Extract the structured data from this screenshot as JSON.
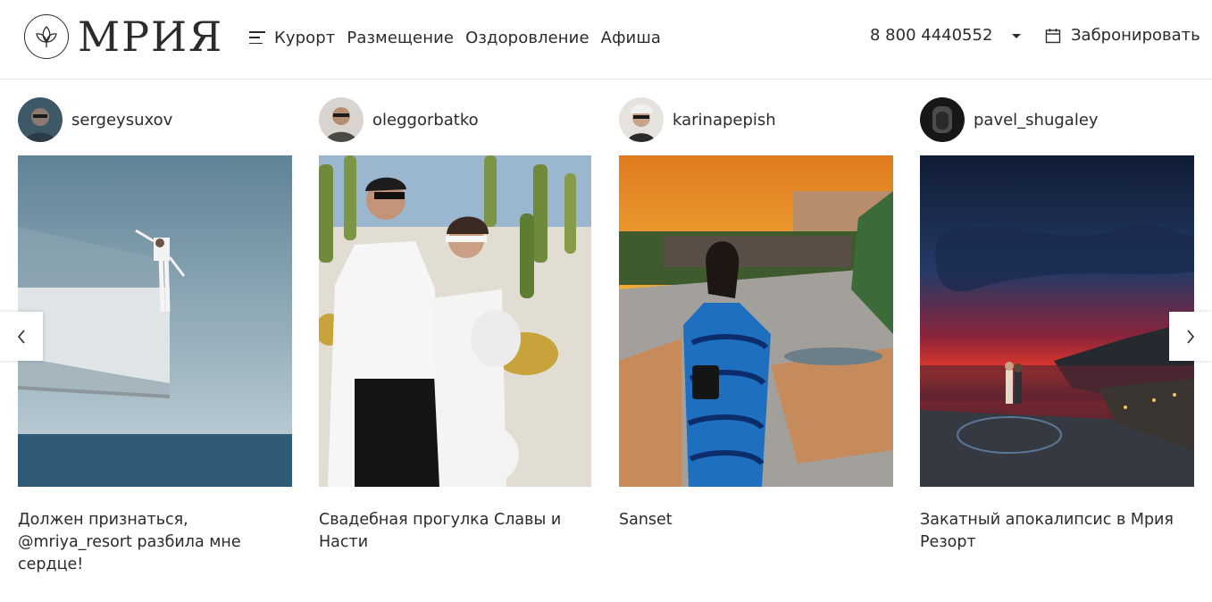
{
  "brand": {
    "name": "МРИЯ",
    "logo_icon": "leaf-emblem-icon"
  },
  "nav": {
    "menu_icon": "hamburger-menu-icon",
    "items": [
      "Курорт",
      "Размещение",
      "Оздоровление",
      "Афиша"
    ]
  },
  "contact": {
    "phone": "8 800 4440552",
    "dropdown_icon": "chevron-down-icon"
  },
  "booking": {
    "icon": "calendar-icon",
    "label": "Забронировать"
  },
  "carousel": {
    "prev_icon": "chevron-left-icon",
    "next_icon": "chevron-right-icon",
    "posts": [
      {
        "username": "sergeysuxov",
        "caption": "Должен признаться, @mriya_resort разбила мне сердце!"
      },
      {
        "username": "oleggorbatko",
        "caption": "Свадебная прогулка Славы и Насти"
      },
      {
        "username": "karinapepish",
        "caption": "Sanset"
      },
      {
        "username": "pavel_shugaley",
        "caption": "Закатный апокалипсис в Мрия Резорт"
      }
    ]
  },
  "colors": {
    "text": "#2b2b2b",
    "divider": "#e2e2e2",
    "background": "#ffffff"
  }
}
